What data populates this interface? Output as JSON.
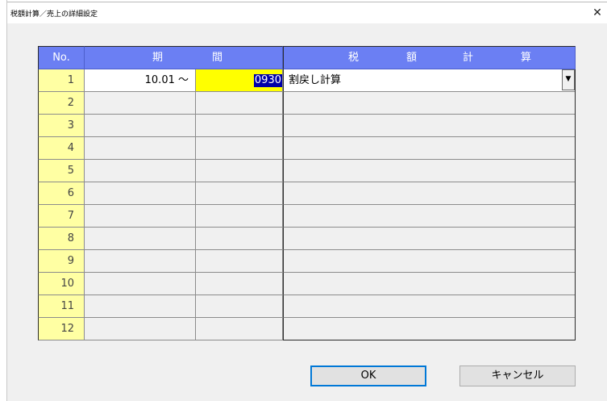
{
  "window": {
    "title": "税額計算／売上の詳細設定",
    "close_glyph": "✕"
  },
  "grid": {
    "headers": {
      "no": "No.",
      "period_left": "期",
      "period_right": "間",
      "calc_chars": [
        "税",
        "額",
        "計",
        "算"
      ]
    },
    "rows": [
      {
        "no": "1",
        "start": "10.01 ～",
        "end": "0930",
        "calc": "割戻し計算"
      },
      {
        "no": "2",
        "start": "",
        "end": "",
        "calc": ""
      },
      {
        "no": "3",
        "start": "",
        "end": "",
        "calc": ""
      },
      {
        "no": "4",
        "start": "",
        "end": "",
        "calc": ""
      },
      {
        "no": "5",
        "start": "",
        "end": "",
        "calc": ""
      },
      {
        "no": "6",
        "start": "",
        "end": "",
        "calc": ""
      },
      {
        "no": "7",
        "start": "",
        "end": "",
        "calc": ""
      },
      {
        "no": "8",
        "start": "",
        "end": "",
        "calc": ""
      },
      {
        "no": "9",
        "start": "",
        "end": "",
        "calc": ""
      },
      {
        "no": "10",
        "start": "",
        "end": "",
        "calc": ""
      },
      {
        "no": "11",
        "start": "",
        "end": "",
        "calc": ""
      },
      {
        "no": "12",
        "start": "",
        "end": "",
        "calc": ""
      }
    ],
    "dropdown_icon": "chevron-down-icon",
    "dropdown_glyph": "▼"
  },
  "buttons": {
    "ok": "OK",
    "cancel": "キャンセル"
  },
  "colors": {
    "header_bg": "#6b7ff3",
    "no_col_bg": "#ffffa3",
    "active_cell_bg": "#ffff00",
    "selection_bg": "#0000a8"
  }
}
